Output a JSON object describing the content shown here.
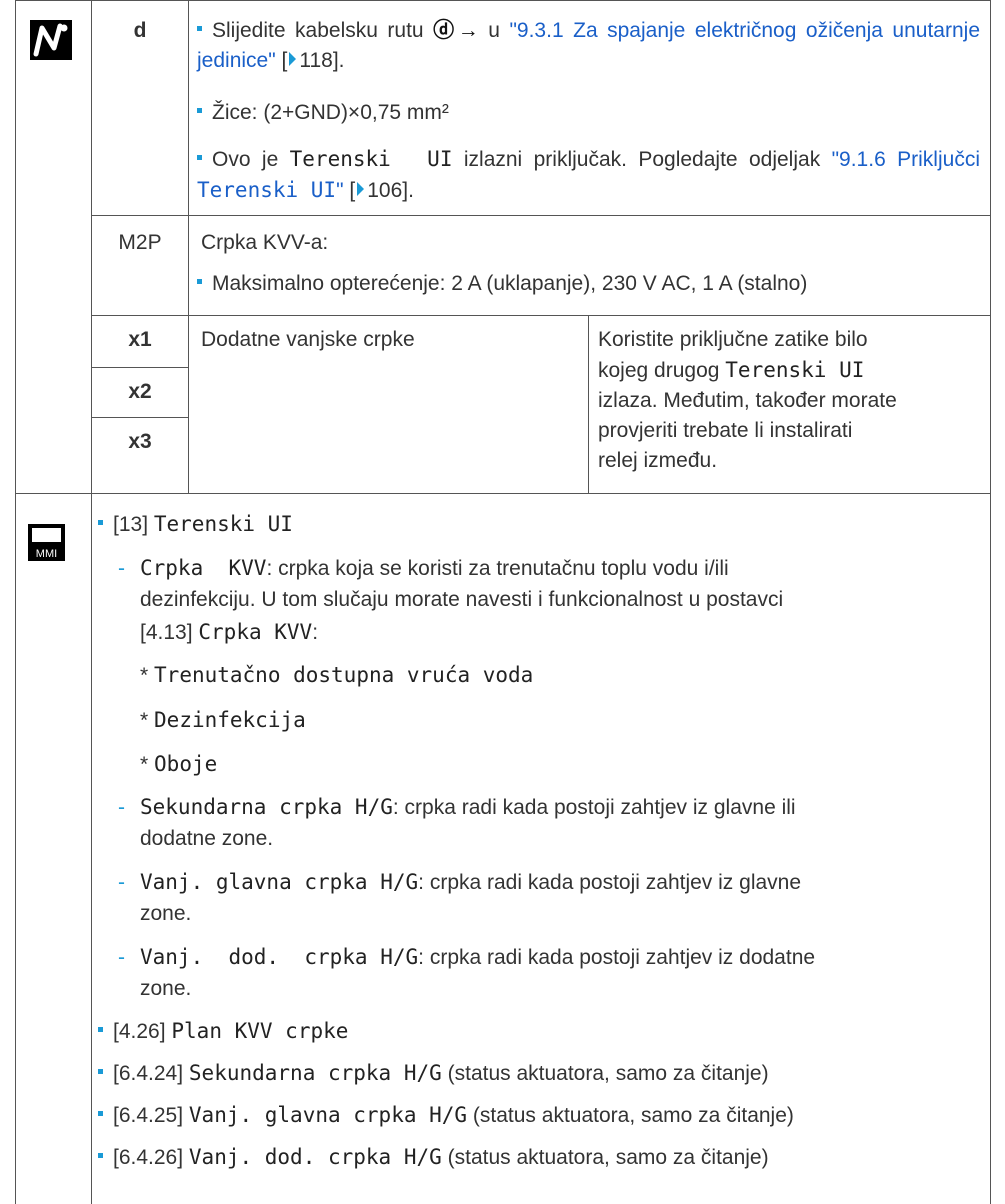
{
  "row_d": {
    "code": "d",
    "b1_text": "Slijedite kabelsku rutu",
    "b1_symbol": "ⓓ→",
    "b1_u": "u",
    "b1_link": "\"9.3.1 Za spajanje električnog ožičenja unutarnje jedinice\"",
    "b1_page_open": "[",
    "b1_page": "118",
    "b1_page_close": "].",
    "b2": "Žice: (2+GND)×0,75 mm²",
    "b3_a": "Ovo je",
    "b3_mono": "Terenski  UI",
    "b3_b": "izlazni priključak. Pogledajte odjeljak",
    "b3_link_a": "\"9.1.6 Priključci",
    "b3_link_mono": "Terenski UI",
    "b3_link_b": "\"",
    "b3_page_open": "[",
    "b3_page": "106",
    "b3_page_close": "]."
  },
  "row_m2p": {
    "code": "M2P",
    "title": "Crpka KVV-a:",
    "b1": "Maksimalno opterećenje: 2 A (uklapanje), 230 V AC, 1 A (stalno)"
  },
  "row_x": {
    "codes": [
      "x1",
      "x2",
      "x3"
    ],
    "desc": "Dodatne vanjske crpke",
    "note_lines": [
      "Koristite priključne zatike bilo",
      "kojeg drugog",
      "izlaza. Međutim, također morate",
      "provjeriti trebate li instalirati",
      "relej između."
    ],
    "note_mono": "Terenski UI"
  },
  "mmi": {
    "icon_label": "MMI",
    "item13_ref": "[13]",
    "item13_mono": "Terenski UI",
    "sub1_mono": "Crpka  KVV",
    "sub1_text_l1": ": crpka koja se koristi za trenutačnu toplu vodu i/ili",
    "sub1_text_l2": "dezinfekciju. U tom slučaju morate navesti i funkcionalnost u postavci",
    "sub1_ref": "[4.13]",
    "sub1_ref_mono": "Crpka KVV",
    "sub1_colon": ":",
    "opt_star": "*",
    "opt1": "Trenutačno dostupna vruća voda",
    "opt2": "Dezinfekcija",
    "opt3": "Oboje",
    "sub2_mono": "Sekundarna crpka H/G",
    "sub2_text": ": crpka radi kada postoji zahtjev iz glavne ili",
    "sub2_text_l2": "dodatne zone.",
    "sub3_mono": "Vanj. glavna crpka H/G",
    "sub3_text": ": crpka radi kada postoji zahtjev iz glavne",
    "sub3_text_l2": "zone.",
    "sub4_mono": "Vanj.  dod.  crpka H/G",
    "sub4_text": ": crpka radi kada postoji zahtjev iz dodatne",
    "sub4_text_l2": "zone.",
    "b2_ref": "[4.26]",
    "b2_mono": "Plan KVV crpke",
    "b3_ref": "[6.4.24]",
    "b3_mono": "Sekundarna crpka H/G",
    "b3_text": "(status aktuatora, samo za čitanje)",
    "b4_ref": "[6.4.25]",
    "b4_mono": "Vanj. glavna crpka H/G",
    "b4_text": "(status aktuatora, samo za čitanje)",
    "b5_ref": "[6.4.26]",
    "b5_mono": "Vanj. dod. crpka H/G",
    "b5_text": "(status aktuatora, samo za čitanje)"
  }
}
